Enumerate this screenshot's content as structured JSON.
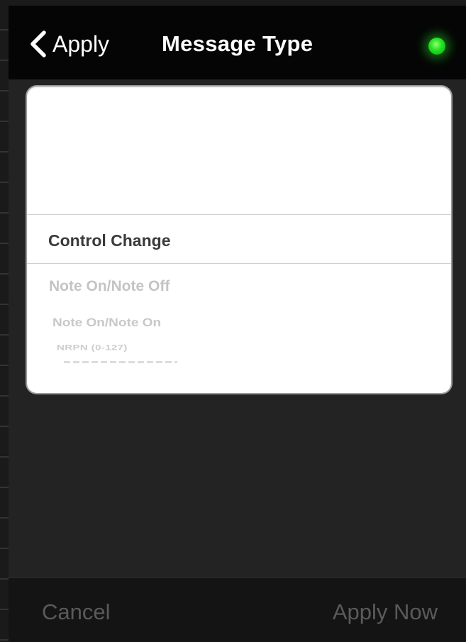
{
  "navbar": {
    "back_label": "Apply",
    "title": "Message Type",
    "status_color": "#22dd22"
  },
  "picker": {
    "selected": "Control Change",
    "options_below": [
      "Note On/Note Off",
      "Note On/Note On",
      "NRPN (0-127)"
    ]
  },
  "toolbar": {
    "cancel_label": "Cancel",
    "apply_label": "Apply Now"
  }
}
